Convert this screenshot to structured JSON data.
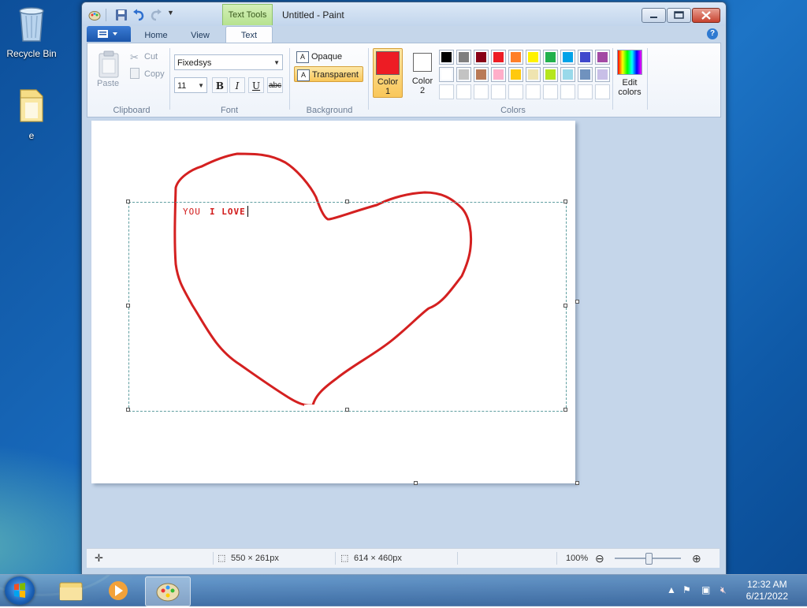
{
  "desktop": {
    "icons": [
      {
        "label": "Recycle Bin"
      },
      {
        "label": "e"
      }
    ]
  },
  "window": {
    "title": "Untitled - Paint",
    "context_tab": "Text Tools"
  },
  "tabs": [
    {
      "label": "Home"
    },
    {
      "label": "View"
    },
    {
      "label": "Text"
    }
  ],
  "ribbon": {
    "clipboard": {
      "paste": "Paste",
      "cut": "Cut",
      "copy": "Copy",
      "group": "Clipboard"
    },
    "font": {
      "family": "Fixedsys",
      "size": "11",
      "bold": "B",
      "italic": "I",
      "underline": "U",
      "strike": "abc",
      "group": "Font"
    },
    "background": {
      "opaque": "Opaque",
      "transparent": "Transparent",
      "group": "Background",
      "selected": "Transparent"
    },
    "colors": {
      "color1_label": "Color",
      "color1_num": "1",
      "color2_label": "Color",
      "color2_num": "2",
      "edit_label": "Edit",
      "edit_label2": "colors",
      "group": "Colors",
      "color1": "#ed1c24",
      "color2": "#ffffff",
      "palette_row1": [
        "#000000",
        "#7f7f7f",
        "#880015",
        "#ed1c24",
        "#ff7f27",
        "#fff200",
        "#22b14c",
        "#00a2e8",
        "#3f48cc",
        "#a349a4"
      ],
      "palette_row2": [
        "#ffffff",
        "#c3c3c3",
        "#b97a57",
        "#ffaec9",
        "#ffc90e",
        "#efe4b0",
        "#b5e61d",
        "#99d9ea",
        "#7092be",
        "#c8bfe7"
      ],
      "palette_row3": [
        "",
        "",
        "",
        "",
        "",
        "",
        "",
        "",
        "",
        ""
      ]
    }
  },
  "canvas": {
    "text_part1": "YOU",
    "text_part2": "I LOVE",
    "stroke_color": "#d42020"
  },
  "status": {
    "selection_size": "550 × 261px",
    "canvas_size": "614 × 460px",
    "zoom": "100%",
    "zoom_level": 0.5
  },
  "taskbar": {
    "time": "12:32 AM",
    "date": "6/21/2022"
  }
}
